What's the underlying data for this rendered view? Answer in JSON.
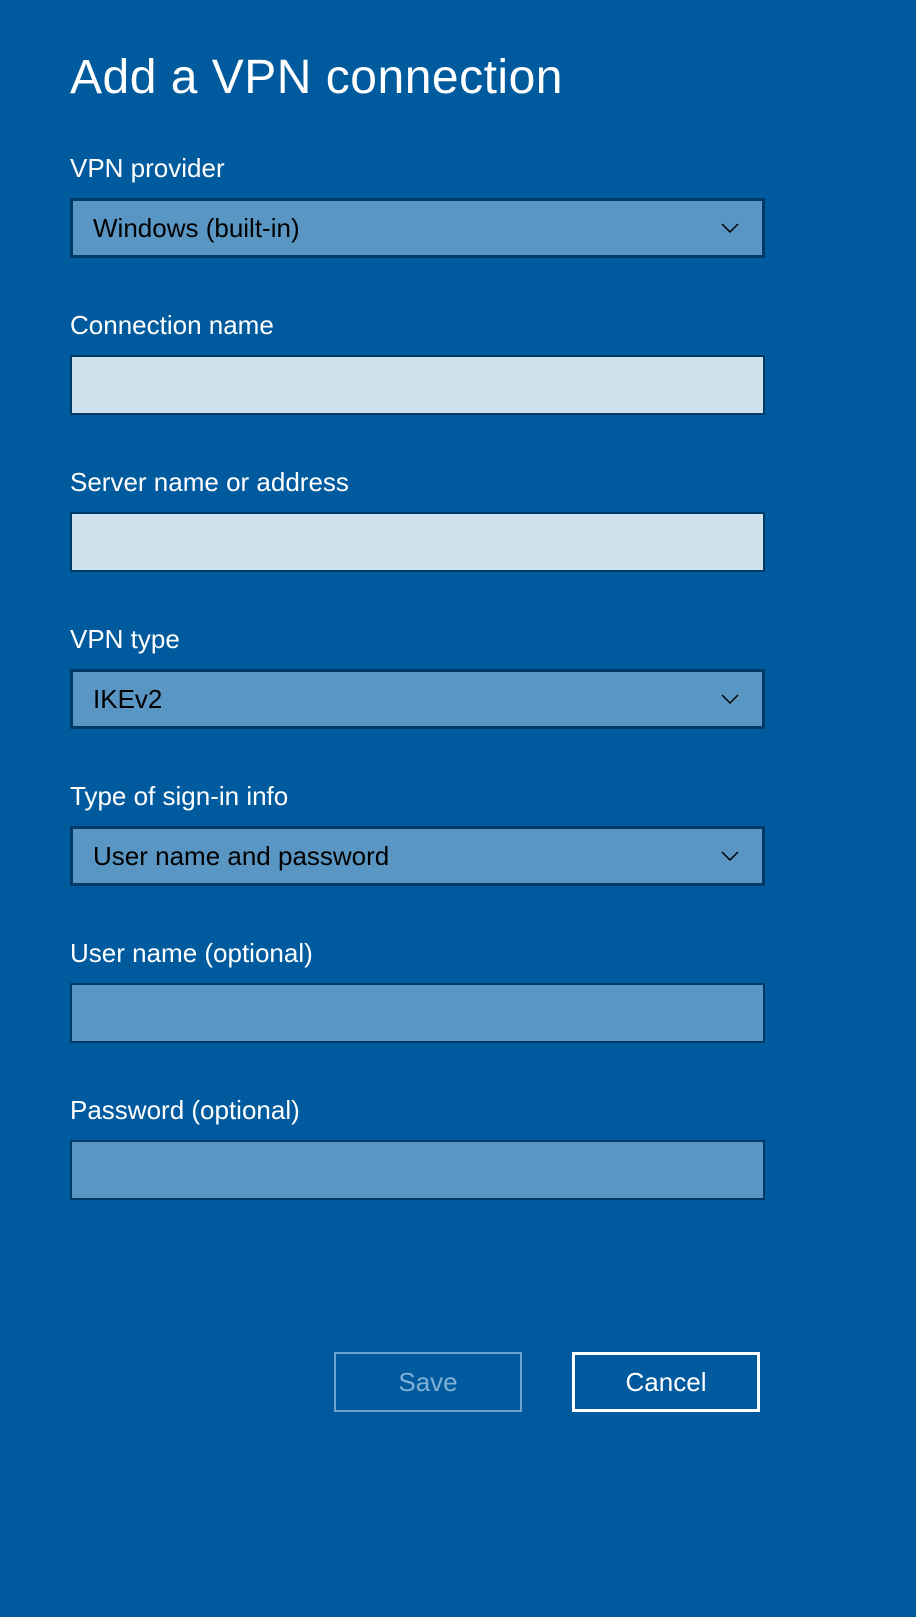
{
  "title": "Add a VPN connection",
  "fields": {
    "vpn_provider": {
      "label": "VPN provider",
      "value": "Windows (built-in)"
    },
    "connection_name": {
      "label": "Connection name",
      "value": ""
    },
    "server_address": {
      "label": "Server name or address",
      "value": ""
    },
    "vpn_type": {
      "label": "VPN type",
      "value": "IKEv2"
    },
    "signin_type": {
      "label": "Type of sign-in info",
      "value": "User name and password"
    },
    "username": {
      "label": "User name (optional)",
      "value": ""
    },
    "password": {
      "label": "Password (optional)",
      "value": ""
    }
  },
  "buttons": {
    "save": "Save",
    "cancel": "Cancel"
  }
}
